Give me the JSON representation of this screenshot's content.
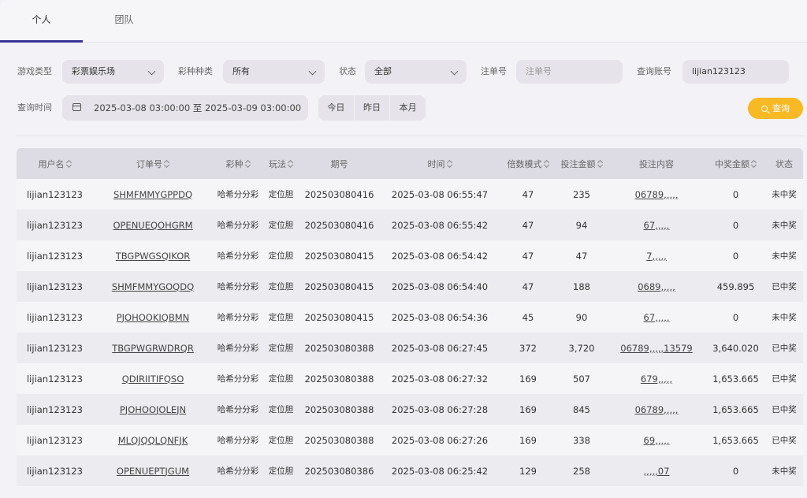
{
  "tabs": [
    {
      "label": "个人",
      "active": true
    },
    {
      "label": "团队",
      "active": false
    }
  ],
  "filters": {
    "game_type_label": "游戏类型",
    "game_type_value": "彩票娱乐场",
    "lottery_kind_label": "彩种种类",
    "lottery_kind_value": "所有",
    "status_label": "状态",
    "status_value": "全部",
    "order_no_label": "注单号",
    "order_no_placeholder": "注单号",
    "query_account_label": "查询账号",
    "query_account_value": "lijian123123",
    "query_time_label": "查询时间",
    "date_range": "2025-03-08 03:00:00 至 2025-03-09 03:00:00",
    "quick_today": "今日",
    "quick_yesterday": "昨日",
    "quick_month": "本月",
    "query_button": "查询"
  },
  "table": {
    "headers": [
      "用户名",
      "订单号",
      "彩种",
      "玩法",
      "期号",
      "时间",
      "倍数模式",
      "投注金额",
      "投注内容",
      "中奖金额",
      "状态"
    ],
    "rows": [
      [
        "lijian123123",
        "SHMFMMYGPPDQ",
        "哈希分分彩",
        "定位胆",
        "202503080416",
        "2025-03-08 06:55:47",
        "47",
        "235",
        "06789,,,,,",
        "0",
        "未中奖"
      ],
      [
        "lijian123123",
        "OPENUEQOHGRM",
        "哈希分分彩",
        "定位胆",
        "202503080416",
        "2025-03-08 06:55:42",
        "47",
        "94",
        "67,,,,,",
        "0",
        "未中奖"
      ],
      [
        "lijian123123",
        "TBGPWGSQIKOR",
        "哈希分分彩",
        "定位胆",
        "202503080415",
        "2025-03-08 06:54:42",
        "47",
        "47",
        "7,,,,,",
        "0",
        "未中奖"
      ],
      [
        "lijian123123",
        "SHMFMMYGOQDQ",
        "哈希分分彩",
        "定位胆",
        "202503080415",
        "2025-03-08 06:54:40",
        "47",
        "188",
        "0689,,,,,",
        "459.895",
        "已中奖"
      ],
      [
        "lijian123123",
        "PJOHOOKIQBMN",
        "哈希分分彩",
        "定位胆",
        "202503080415",
        "2025-03-08 06:54:36",
        "45",
        "90",
        "67,,,,,",
        "0",
        "未中奖"
      ],
      [
        "lijian123123",
        "TBGPWGRWDRQR",
        "哈希分分彩",
        "定位胆",
        "202503080388",
        "2025-03-08 06:27:45",
        "372",
        "3,720",
        "06789,,,,,13579",
        "3,640.020",
        "已中奖"
      ],
      [
        "lijian123123",
        "QDIRIITIFQSO",
        "哈希分分彩",
        "定位胆",
        "202503080388",
        "2025-03-08 06:27:32",
        "169",
        "507",
        "679,,,,,",
        "1,653.665",
        "已中奖"
      ],
      [
        "lijian123123",
        "PJOHOOJOLEJN",
        "哈希分分彩",
        "定位胆",
        "202503080388",
        "2025-03-08 06:27:28",
        "169",
        "845",
        "06789,,,,,",
        "1,653.665",
        "已中奖"
      ],
      [
        "lijian123123",
        "MLQJQQLQNFJK",
        "哈希分分彩",
        "定位胆",
        "202503080388",
        "2025-03-08 06:27:26",
        "169",
        "338",
        "69,,,,,",
        "1,653.665",
        "已中奖"
      ],
      [
        "lijian123123",
        "OPENUEPTJGUM",
        "哈希分分彩",
        "定位胆",
        "202503080386",
        "2025-03-08 06:25:42",
        "129",
        "258",
        ",,,,,07",
        "0",
        "未中奖"
      ]
    ]
  }
}
